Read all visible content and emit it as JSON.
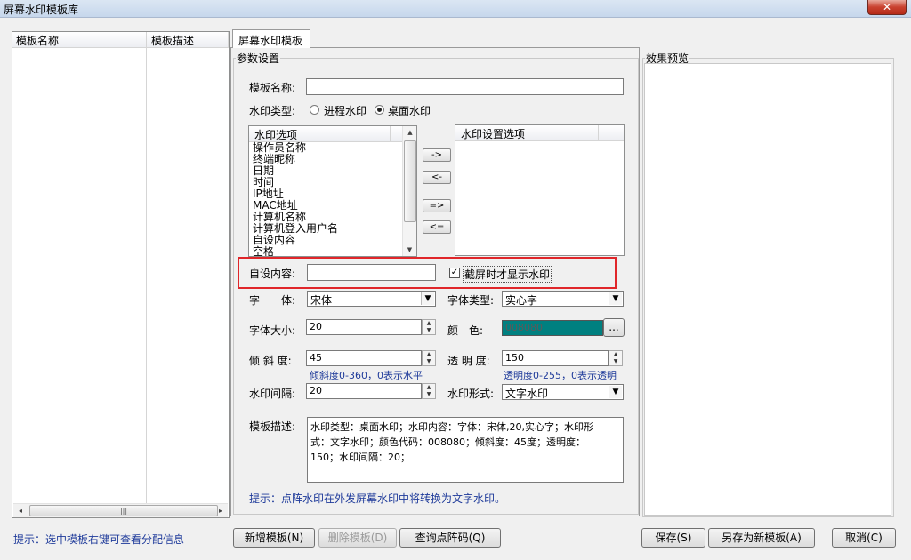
{
  "window": {
    "title": "屏幕水印模板库",
    "close_glyph": "✕"
  },
  "left_panel": {
    "columns": [
      "模板名称",
      "模板描述"
    ],
    "rows": [],
    "scroll": {
      "left": "◂",
      "right": "▸",
      "thumb": "|||"
    }
  },
  "tab": {
    "label": "屏幕水印模板"
  },
  "params": {
    "group_title": "参数设置",
    "template_name_label": "模板名称:",
    "template_name_value": "",
    "watermark_type_label": "水印类型:",
    "type_options": [
      {
        "label": "进程水印",
        "selected": false
      },
      {
        "label": "桌面水印",
        "selected": true
      }
    ],
    "options_list": {
      "header": "水印选项",
      "items": [
        "操作员名称",
        "终端昵称",
        "日期",
        "时间",
        "IP地址",
        "MAC地址",
        "计算机名称",
        "计算机登入用户名",
        "自设内容",
        "空格"
      ]
    },
    "settings_list": {
      "header": "水印设置选项",
      "items": []
    },
    "move_buttons": [
      "->",
      "<-",
      "=>",
      "<="
    ],
    "custom_content_label": "自设内容:",
    "custom_content_value": "",
    "screenshot_only_label": "截屏时才显示水印",
    "screenshot_only_checked": true,
    "font_label": "字　　体:",
    "font_value": "宋体",
    "font_type_label": "字体类型:",
    "font_type_value": "实心字",
    "font_size_label": "字体大小:",
    "font_size_value": "20",
    "color_label": "颜　色:",
    "color_value": "008080",
    "color_hex": "#008080",
    "color_button": "...",
    "tilt_label": "倾 斜 度:",
    "tilt_value": "45",
    "tilt_hint": "倾斜度0-360，0表示水平",
    "opacity_label": "透 明 度:",
    "opacity_value": "150",
    "opacity_hint": "透明度0-255，0表示透明",
    "interval_label": "水印间隔:",
    "interval_value": "20",
    "form_label": "水印形式:",
    "form_value": "文字水印",
    "description_label": "模板描述:",
    "description_lines": [
      "水印类型：桌面水印；水印内容：字体：宋体,20,实心字；水印形",
      "式：文字水印；颜色代码：008080；倾斜度：45度；透明度：",
      "150；水印间隔：20；"
    ],
    "tip": "提示：点阵水印在外发屏幕水印中将转换为文字水印。"
  },
  "preview": {
    "title": "效果预览"
  },
  "footer": {
    "left_tip": "提示：选中模板右键可查看分配信息",
    "new_button": "新增模板(N)",
    "delete_button": "删除模板(D)",
    "query_button": "查询点阵码(Q)",
    "save_button": "保存(S)",
    "save_as_button": "另存为新模板(A)",
    "cancel_button": "取消(C)"
  }
}
